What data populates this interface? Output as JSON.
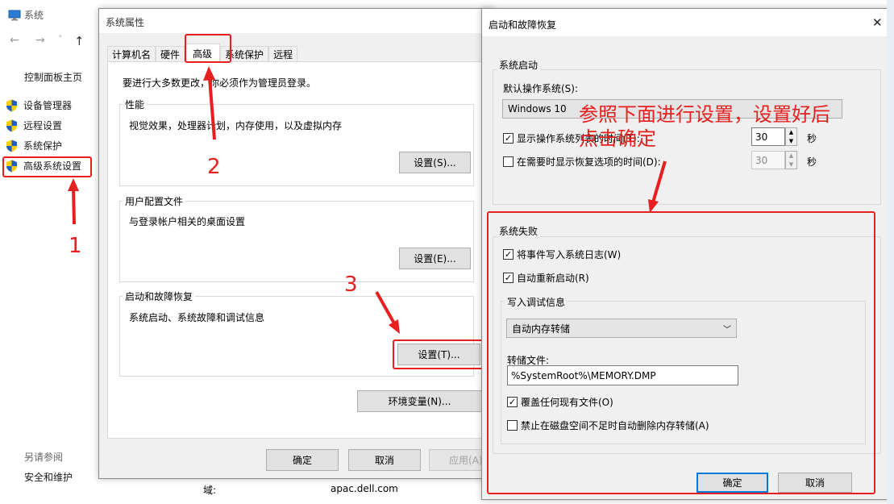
{
  "system_window": {
    "title": "系统",
    "nav": {
      "back": "←",
      "forward": "→",
      "dropdown": "˅",
      "up": "↑"
    },
    "sidebar": {
      "home": "控制面板主页",
      "items": [
        {
          "label": "设备管理器",
          "icon": "shield-icon"
        },
        {
          "label": "远程设置",
          "icon": "shield-icon"
        },
        {
          "label": "系统保护",
          "icon": "shield-icon"
        },
        {
          "label": "高级系统设置",
          "icon": "shield-icon"
        }
      ],
      "see_also": "另请参阅",
      "security_link": "安全和维护"
    },
    "domain_label": "域:",
    "domain_value": "apac.dell.com"
  },
  "system_properties": {
    "title": "系统属性",
    "tabs": [
      "计算机名",
      "硬件",
      "高级",
      "系统保护",
      "远程"
    ],
    "active_tab": "高级",
    "admin_note": "要进行大多数更改，你必须作为管理员登录。",
    "performance": {
      "label": "性能",
      "desc": "视觉效果，处理器计划，内存使用，以及虚拟内存",
      "button": "设置(S)..."
    },
    "user_profiles": {
      "label": "用户配置文件",
      "desc": "与登录帐户相关的桌面设置",
      "button": "设置(E)..."
    },
    "startup_recovery": {
      "label": "启动和故障恢复",
      "desc": "系统启动、系统故障和调试信息",
      "button": "设置(T)..."
    },
    "env_button": "环境变量(N)...",
    "ok": "确定",
    "cancel": "取消",
    "apply": "应用(A)"
  },
  "startup_dialog": {
    "title": "启动和故障恢复",
    "close": "✕",
    "system_startup": {
      "label": "系统启动",
      "default_os_label": "默认操作系统(S):",
      "default_os_value": "Windows 10",
      "show_os_list": {
        "label": "显示操作系统列表的时间(T):",
        "checked": true,
        "value": "30",
        "unit": "秒"
      },
      "show_recovery": {
        "label": "在需要时显示恢复选项的时间(D):",
        "checked": false,
        "value": "30",
        "unit": "秒"
      }
    },
    "system_failure": {
      "label": "系统失败",
      "write_event": {
        "label": "将事件写入系统日志(W)",
        "checked": true
      },
      "auto_restart": {
        "label": "自动重新启动(R)",
        "checked": true
      },
      "debug_info": {
        "label": "写入调试信息",
        "selected": "自动内存转储",
        "dump_file_label": "转储文件:",
        "dump_file_value": "%SystemRoot%\\MEMORY.DMP",
        "overwrite": {
          "label": "覆盖任何现有文件(O)",
          "checked": true
        },
        "disable_auto_delete": {
          "label": "禁止在磁盘空间不足时自动删除内存转储(A)",
          "checked": false
        }
      }
    },
    "ok": "确定",
    "cancel": "取消"
  },
  "annotations": {
    "num1": "1",
    "num2": "2",
    "num3": "3",
    "instruction_line1": "参照下面进行设置，设置好后",
    "instruction_line2": "点击确定",
    "color": "#e81f1f"
  },
  "check_glyph": "✓"
}
